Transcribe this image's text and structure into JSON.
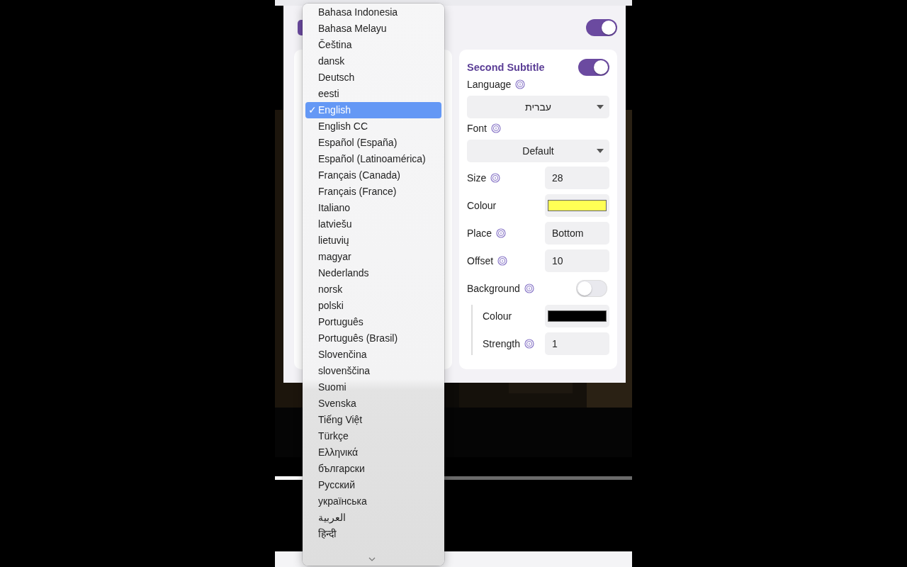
{
  "popup": {
    "enabled": true
  },
  "second_subtitle": {
    "title": "Second Subtitle",
    "enabled": true,
    "settings": [
      {
        "kind": "select",
        "label": "Language",
        "info": true,
        "value": "עברית"
      },
      {
        "kind": "select",
        "label": "Font",
        "info": true,
        "value": "Default"
      },
      {
        "kind": "input",
        "label": "Size",
        "info": true,
        "value": "28"
      },
      {
        "kind": "swatch",
        "label": "Colour",
        "info": false,
        "color": "#ffff55"
      },
      {
        "kind": "input",
        "label": "Place",
        "info": true,
        "value": "Bottom"
      },
      {
        "kind": "input",
        "label": "Offset",
        "info": true,
        "value": "10"
      },
      {
        "kind": "toggle",
        "label": "Background",
        "info": true,
        "on": false,
        "children": [
          {
            "kind": "swatch",
            "label": "Colour",
            "info": false,
            "color": "#000000"
          },
          {
            "kind": "input",
            "label": "Strength",
            "info": true,
            "value": "1"
          }
        ]
      }
    ]
  },
  "language_menu": {
    "check_mark": "✓",
    "items": [
      {
        "label": "Bahasa Indonesia",
        "selected": false
      },
      {
        "label": "Bahasa Melayu",
        "selected": false
      },
      {
        "label": "Čeština",
        "selected": false
      },
      {
        "label": "dansk",
        "selected": false
      },
      {
        "label": "Deutsch",
        "selected": false
      },
      {
        "label": "eesti",
        "selected": false
      },
      {
        "label": "English",
        "selected": true
      },
      {
        "label": "English CC",
        "selected": false
      },
      {
        "label": "Español (España)",
        "selected": false
      },
      {
        "label": "Español (Latinoamérica)",
        "selected": false
      },
      {
        "label": "Français (Canada)",
        "selected": false
      },
      {
        "label": "Français (France)",
        "selected": false
      },
      {
        "label": "Italiano",
        "selected": false
      },
      {
        "label": "latviešu",
        "selected": false
      },
      {
        "label": "lietuvių",
        "selected": false
      },
      {
        "label": "magyar",
        "selected": false
      },
      {
        "label": "Nederlands",
        "selected": false
      },
      {
        "label": "norsk",
        "selected": false
      },
      {
        "label": "polski",
        "selected": false
      },
      {
        "label": "Português",
        "selected": false
      },
      {
        "label": "Português (Brasil)",
        "selected": false
      },
      {
        "label": "Slovenčina",
        "selected": false
      },
      {
        "label": "slovenščina",
        "selected": false
      },
      {
        "label": "Suomi",
        "selected": false
      },
      {
        "label": "Svenska",
        "selected": false
      },
      {
        "label": "Tiếng Việt",
        "selected": false
      },
      {
        "label": "Türkçe",
        "selected": false
      },
      {
        "label": "Ελληνικά",
        "selected": false
      },
      {
        "label": "български",
        "selected": false
      },
      {
        "label": "Русский",
        "selected": false
      },
      {
        "label": "українська",
        "selected": false
      },
      {
        "label": "العربية",
        "selected": false
      },
      {
        "label": "हिन्दी",
        "selected": false
      }
    ]
  },
  "player": {
    "progress": {
      "level": 0.28
    }
  }
}
